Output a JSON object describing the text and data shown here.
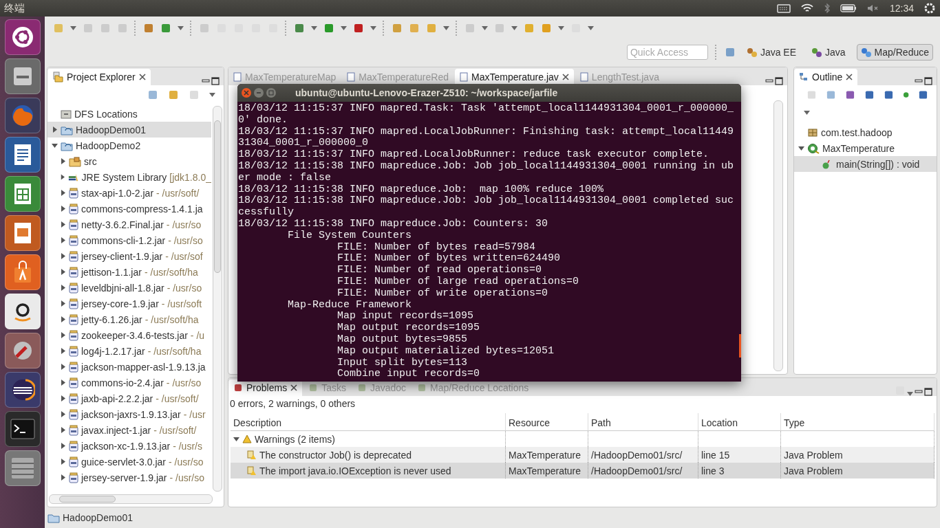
{
  "top_bar": {
    "app_title": "终端",
    "time": "12:34"
  },
  "quick_access": {
    "placeholder": "Quick Access"
  },
  "perspectives": [
    {
      "label": "Java EE",
      "selected": false
    },
    {
      "label": "Java",
      "selected": false
    },
    {
      "label": "Map/Reduce",
      "selected": true
    }
  ],
  "project_explorer": {
    "title": "Project Explorer",
    "items": [
      {
        "label": "DFS Locations",
        "kind": "dfs",
        "selected": false
      },
      {
        "label": "HadoopDemo01",
        "kind": "project",
        "expanded": false,
        "selected": true
      },
      {
        "label": "HadoopDemo2",
        "kind": "project",
        "expanded": true,
        "selected": false,
        "children": [
          {
            "label": "src",
            "kind": "source",
            "expanded": false,
            "selected": false
          },
          {
            "label": "JRE System Library",
            "decoration": "[jdk1.8.0_",
            "kind": "library",
            "expanded": false,
            "selected": false
          },
          {
            "label": "stax-api-1.0-2.jar",
            "decoration": "- /usr/soft/",
            "kind": "jar",
            "expanded": false,
            "selected": false
          },
          {
            "label": "commons-compress-1.4.1.ja",
            "kind": "jar",
            "expanded": false,
            "selected": false
          },
          {
            "label": "netty-3.6.2.Final.jar",
            "decoration": "- /usr/so",
            "kind": "jar",
            "expanded": false,
            "selected": false
          },
          {
            "label": "commons-cli-1.2.jar",
            "decoration": "- /usr/so",
            "kind": "jar",
            "expanded": false,
            "selected": false
          },
          {
            "label": "jersey-client-1.9.jar",
            "decoration": "- /usr/sof",
            "kind": "jar",
            "expanded": false,
            "selected": false
          },
          {
            "label": "jettison-1.1.jar",
            "decoration": "- /usr/soft/ha",
            "kind": "jar",
            "expanded": false,
            "selected": false
          },
          {
            "label": "leveldbjni-all-1.8.jar",
            "decoration": "- /usr/so",
            "kind": "jar",
            "expanded": false,
            "selected": false
          },
          {
            "label": "jersey-core-1.9.jar",
            "decoration": "- /usr/soft",
            "kind": "jar",
            "expanded": false,
            "selected": false
          },
          {
            "label": "jetty-6.1.26.jar",
            "decoration": "- /usr/soft/ha",
            "kind": "jar",
            "expanded": false,
            "selected": false
          },
          {
            "label": "zookeeper-3.4.6-tests.jar",
            "decoration": "- /u",
            "kind": "jar",
            "expanded": false,
            "selected": false
          },
          {
            "label": "log4j-1.2.17.jar",
            "decoration": "- /usr/soft/ha",
            "kind": "jar",
            "expanded": false,
            "selected": false
          },
          {
            "label": "jackson-mapper-asl-1.9.13.ja",
            "kind": "jar",
            "expanded": false,
            "selected": false
          },
          {
            "label": "commons-io-2.4.jar",
            "decoration": "- /usr/so",
            "kind": "jar",
            "expanded": false,
            "selected": false
          },
          {
            "label": "jaxb-api-2.2.2.jar",
            "decoration": "- /usr/soft/",
            "kind": "jar",
            "expanded": false,
            "selected": false
          },
          {
            "label": "jackson-jaxrs-1.9.13.jar",
            "decoration": "- /usr",
            "kind": "jar",
            "expanded": false,
            "selected": false
          },
          {
            "label": "javax.inject-1.jar",
            "decoration": "- /usr/soft/",
            "kind": "jar",
            "expanded": false,
            "selected": false
          },
          {
            "label": "jackson-xc-1.9.13.jar",
            "decoration": "- /usr/s",
            "kind": "jar",
            "expanded": false,
            "selected": false
          },
          {
            "label": "guice-servlet-3.0.jar",
            "decoration": "- /usr/so",
            "kind": "jar",
            "expanded": false,
            "selected": false
          },
          {
            "label": "jersey-server-1.9.jar",
            "decoration": "- /usr/so",
            "kind": "jar",
            "expanded": false,
            "selected": false
          }
        ]
      }
    ]
  },
  "editor_tabs": [
    {
      "label": "MaxTemperatureMap",
      "selected": false
    },
    {
      "label": "MaxTemperatureRed",
      "selected": false
    },
    {
      "label": "MaxTemperature.jav",
      "selected": true
    },
    {
      "label": "LengthTest.java",
      "selected": false
    }
  ],
  "outline": {
    "title": "Outline",
    "items": [
      {
        "label": "com.test.hadoop",
        "kind": "package",
        "selected": false
      },
      {
        "label": "MaxTemperature",
        "kind": "class",
        "expanded": true,
        "selected": false,
        "children": [
          {
            "label": "main(String[]) : void",
            "kind": "method",
            "selected": true
          }
        ]
      }
    ]
  },
  "terminal": {
    "title": "ubuntu@ubuntu-Lenovo-Erazer-Z510: ~/workspace/jarfile",
    "lines": [
      "18/03/12 11:15:37 INFO mapred.Task: Task 'attempt_local1144931304_0001_r_000000_",
      "0' done.",
      "18/03/12 11:15:37 INFO mapred.LocalJobRunner: Finishing task: attempt_local11449",
      "31304_0001_r_000000_0",
      "18/03/12 11:15:37 INFO mapred.LocalJobRunner: reduce task executor complete.",
      "18/03/12 11:15:38 INFO mapreduce.Job: Job job_local1144931304_0001 running in ub",
      "er mode : false",
      "18/03/12 11:15:38 INFO mapreduce.Job:  map 100% reduce 100%",
      "18/03/12 11:15:38 INFO mapreduce.Job: Job job_local1144931304_0001 completed suc",
      "cessfully",
      "18/03/12 11:15:38 INFO mapreduce.Job: Counters: 30",
      "        File System Counters",
      "                FILE: Number of bytes read=57984",
      "                FILE: Number of bytes written=624490",
      "                FILE: Number of read operations=0",
      "                FILE: Number of large read operations=0",
      "                FILE: Number of write operations=0",
      "        Map-Reduce Framework",
      "                Map input records=1095",
      "                Map output records=1095",
      "                Map output bytes=9855",
      "                Map output materialized bytes=12051",
      "                Input split bytes=113",
      "                Combine input records=0"
    ]
  },
  "problems": {
    "tabs": [
      {
        "label": "Problems",
        "selected": true
      },
      {
        "label": "Tasks",
        "selected": false
      },
      {
        "label": "Javadoc",
        "selected": false
      },
      {
        "label": "Map/Reduce Locations",
        "selected": false
      }
    ],
    "summary": "0 errors, 2 warnings, 0 others",
    "columns": [
      "Description",
      "Resource",
      "Path",
      "Location",
      "Type"
    ],
    "group": {
      "label": "Warnings (2 items)",
      "expanded": true
    },
    "rows": [
      {
        "cells": [
          "The constructor Job() is deprecated",
          "MaxTemperature",
          "/HadoopDemo01/src/",
          "line 15",
          "Java Problem"
        ],
        "selected": false
      },
      {
        "cells": [
          "The import java.io.IOException is never used",
          "MaxTemperature",
          "/HadoopDemo01/src/",
          "line 3",
          "Java Problem"
        ],
        "selected": true
      }
    ]
  },
  "status_bar": {
    "text": "HadoopDemo01"
  }
}
